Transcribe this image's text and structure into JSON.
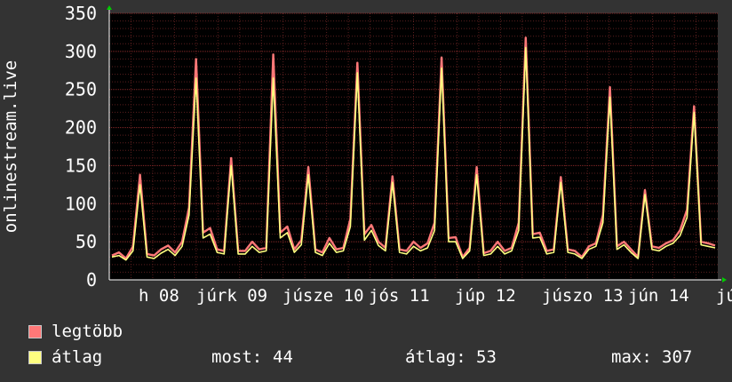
{
  "chart_data": {
    "type": "line",
    "ylabel": "onlinestream.live",
    "ylim": [
      0,
      350
    ],
    "y_ticks": [
      0,
      50,
      100,
      150,
      200,
      250,
      300,
      350
    ],
    "x_tick_labels": [
      "h 08",
      "júrk 09",
      "júsze 10",
      "jós 11",
      "júp 12",
      "júszo 13",
      "jún 14",
      "jú"
    ],
    "grid": true,
    "legend_position": "bottom-left",
    "series": [
      {
        "name": "legtöbb",
        "color": "#ff7878",
        "values": [
          32,
          36,
          28,
          44,
          138,
          34,
          32,
          40,
          45,
          36,
          50,
          95,
          290,
          62,
          68,
          40,
          38,
          160,
          38,
          38,
          50,
          40,
          42,
          296,
          62,
          70,
          40,
          52,
          148,
          40,
          36,
          55,
          40,
          42,
          80,
          285,
          60,
          72,
          50,
          42,
          136,
          40,
          38,
          50,
          42,
          48,
          75,
          292,
          55,
          56,
          30,
          42,
          148,
          35,
          38,
          50,
          38,
          42,
          75,
          318,
          60,
          62,
          38,
          40,
          135,
          40,
          38,
          30,
          44,
          48,
          85,
          253,
          44,
          50,
          40,
          30,
          118,
          44,
          42,
          48,
          52,
          65,
          92,
          228,
          50,
          48,
          45
        ]
      },
      {
        "name": "átlag",
        "color": "#ffff80",
        "values": [
          30,
          32,
          26,
          38,
          125,
          30,
          28,
          35,
          40,
          32,
          44,
          85,
          265,
          55,
          60,
          36,
          34,
          150,
          34,
          34,
          44,
          36,
          38,
          265,
          55,
          62,
          36,
          46,
          138,
          36,
          32,
          48,
          36,
          38,
          70,
          272,
          52,
          65,
          45,
          38,
          128,
          36,
          34,
          44,
          38,
          42,
          65,
          278,
          50,
          50,
          28,
          38,
          138,
          32,
          34,
          44,
          34,
          38,
          65,
          305,
          55,
          56,
          34,
          36,
          128,
          36,
          34,
          28,
          40,
          44,
          75,
          240,
          40,
          46,
          36,
          28,
          112,
          40,
          38,
          44,
          48,
          58,
          82,
          220,
          46,
          44,
          42
        ]
      }
    ]
  },
  "colors": {
    "background": "#333333",
    "plot_area": "#000000",
    "grid": "#5a1e1e",
    "text": "#ffffff",
    "axis_arrow": "#00cc00"
  },
  "legend": {
    "max_label": "legtöbb",
    "avg_label": "átlag"
  },
  "stats": {
    "now_label": "most:",
    "now_value": "44",
    "avg_label": "átlag:",
    "avg_value": "53",
    "max_label": "max:",
    "max_value": "307"
  }
}
